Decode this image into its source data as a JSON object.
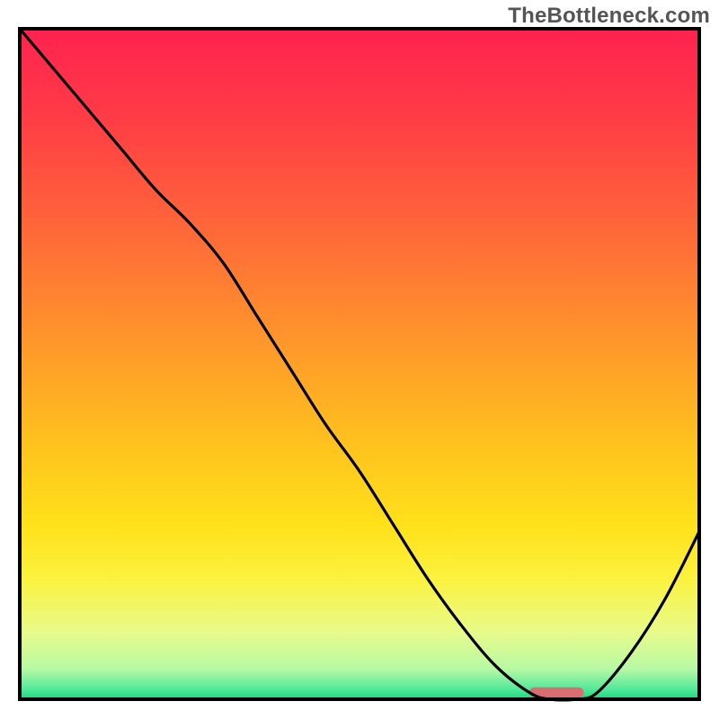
{
  "watermark": "TheBottleneck.com",
  "chart_data": {
    "type": "line",
    "title": "",
    "xlabel": "",
    "ylabel": "",
    "xlim": [
      0,
      100
    ],
    "ylim": [
      0,
      100
    ],
    "x": [
      0,
      5,
      10,
      15,
      20,
      25,
      30,
      35,
      40,
      45,
      50,
      55,
      60,
      65,
      70,
      75,
      78,
      82,
      85,
      90,
      95,
      100
    ],
    "values": [
      100,
      94,
      88,
      82,
      76,
      71,
      65,
      57,
      49,
      41,
      34,
      26,
      18,
      11,
      5,
      1,
      0,
      0,
      1,
      7,
      15,
      25
    ],
    "flat_min_range_x": [
      78,
      82
    ],
    "marker": {
      "x_range": [
        75,
        83
      ],
      "color": "#d96d6f",
      "height": 1.5,
      "radius": 0.75
    },
    "gradient_stops": [
      {
        "offset": 0.0,
        "color": "#ff2250"
      },
      {
        "offset": 0.12,
        "color": "#ff3946"
      },
      {
        "offset": 0.25,
        "color": "#ff5a3d"
      },
      {
        "offset": 0.38,
        "color": "#ff7e32"
      },
      {
        "offset": 0.5,
        "color": "#ffa028"
      },
      {
        "offset": 0.62,
        "color": "#ffc21e"
      },
      {
        "offset": 0.74,
        "color": "#ffe11a"
      },
      {
        "offset": 0.82,
        "color": "#fbf23e"
      },
      {
        "offset": 0.9,
        "color": "#e8fb8a"
      },
      {
        "offset": 0.955,
        "color": "#b7f9a5"
      },
      {
        "offset": 0.985,
        "color": "#52e89a"
      },
      {
        "offset": 1.0,
        "color": "#17db7d"
      }
    ],
    "border_width": 4,
    "curve_width": 3.2
  }
}
